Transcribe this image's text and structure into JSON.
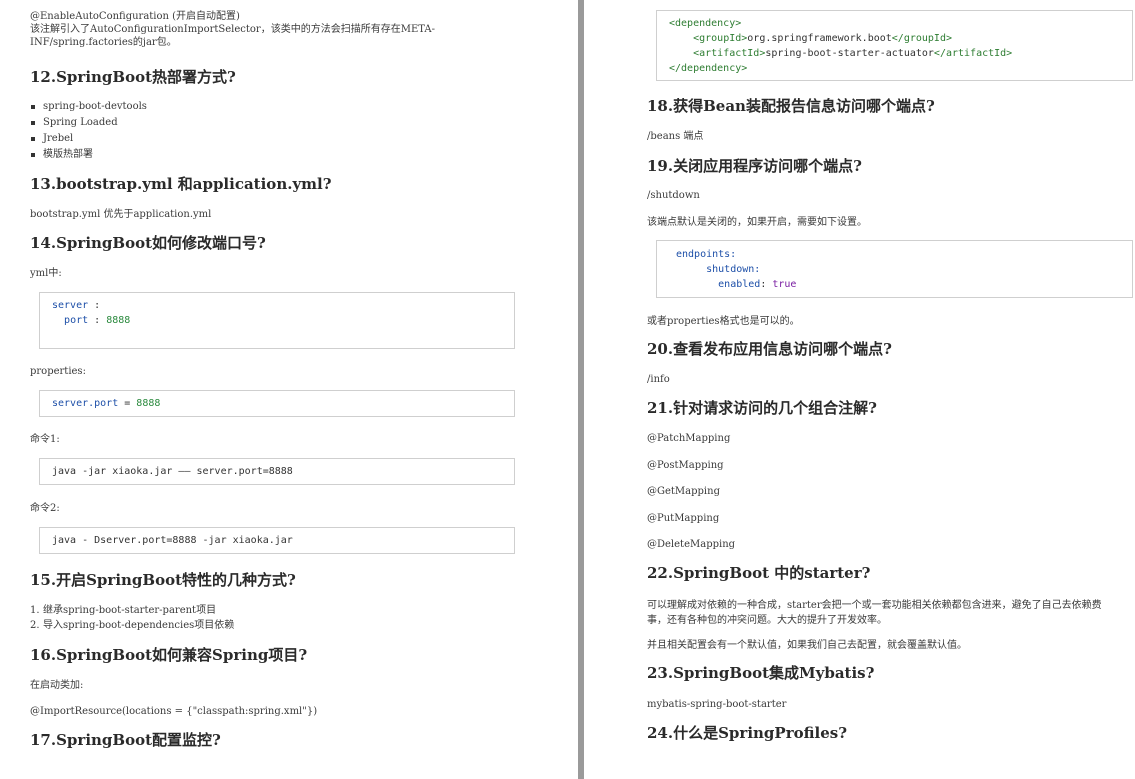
{
  "left": {
    "intro_line1": "@EnableAutoConfiguration (开启自动配置)",
    "intro_line2": "该注解引入了AutoConfigurationImportSelector，该类中的方法会扫描所有存在META-",
    "intro_line3": "INF/spring.factories的jar包。",
    "q12": {
      "title": "12.SpringBoot热部署方式?",
      "items": [
        "spring-boot-devtools",
        "Spring Loaded",
        "Jrebel",
        "模版热部署"
      ]
    },
    "q13": {
      "title": "13.bootstrap.yml 和application.yml?",
      "text": "bootstrap.yml 优先于application.yml"
    },
    "q14": {
      "title": "14.SpringBoot如何修改端口号?",
      "yml_label": "yml中:",
      "yml_code": {
        "k1": "server",
        "sep1": " :",
        "k2": "port",
        "sep2": " : ",
        "v2": "8888"
      },
      "prop_label": "properties:",
      "prop_code": {
        "k": "server.port",
        "sep": " = ",
        "v": "8888"
      },
      "cmd1_label": "命令1:",
      "cmd1_code": "java -jar xiaoka.jar —— server.port=8888",
      "cmd2_label": "命令2:",
      "cmd2_code": "java - Dserver.port=8888 -jar xiaoka.jar"
    },
    "q15": {
      "title": "15.开启SpringBoot特性的几种方式?",
      "items": [
        {
          "n": "1.",
          "t": "继承spring-boot-starter-parent项目"
        },
        {
          "n": "2.",
          "t": "导入spring-boot-dependencies项目依赖"
        }
      ]
    },
    "q16": {
      "title": "16.SpringBoot如何兼容Spring项目?",
      "text1": "在启动类加:",
      "text2": "@ImportResource(locations = {\"classpath:spring.xml\"})"
    },
    "q17": {
      "title": "17.SpringBoot配置监控?"
    }
  },
  "right": {
    "dep_code": {
      "l1": "<dependency>",
      "l2_open": "<groupId>",
      "l2_val": "org.springframework.boot",
      "l2_close": "</groupId>",
      "l3_open": "<artifactId>",
      "l3_val": "spring-boot-starter-actuator",
      "l3_close": "</artifactId>",
      "l4": "</dependency>"
    },
    "q18": {
      "title": "18.获得Bean装配报告信息访问哪个端点?",
      "text": "/beans 端点"
    },
    "q19": {
      "title": "19.关闭应用程序访问哪个端点?",
      "text1": "/shutdown",
      "text2": "该端点默认是关闭的，如果开启，需要如下设置。",
      "code": {
        "k1": "endpoints:",
        "k2": "shutdown:",
        "k3": "enabled",
        "sep3": ": ",
        "v3": "true"
      },
      "text3": "或者properties格式也是可以的。"
    },
    "q20": {
      "title": "20.查看发布应用信息访问哪个端点?",
      "text": "/info"
    },
    "q21": {
      "title": "21.针对请求访问的几个组合注解?",
      "items": [
        "@PatchMapping",
        "@PostMapping",
        "@GetMapping",
        "@PutMapping",
        "@DeleteMapping"
      ]
    },
    "q22": {
      "title": "22.SpringBoot 中的starter?",
      "text1a": "可以理解成对依赖的一种合成，starter会把一个或一套功能相关依赖都包含进来，避免了自己去依赖费",
      "text1b": "事，还有各种包的冲突问题。大大的提升了开发效率。",
      "text2": "并且相关配置会有一个默认值，如果我们自己去配置，就会覆盖默认值。"
    },
    "q23": {
      "title": "23.SpringBoot集成Mybatis?",
      "text": "mybatis-spring-boot-starter"
    },
    "q24": {
      "title": "24.什么是SpringProfiles?"
    }
  }
}
